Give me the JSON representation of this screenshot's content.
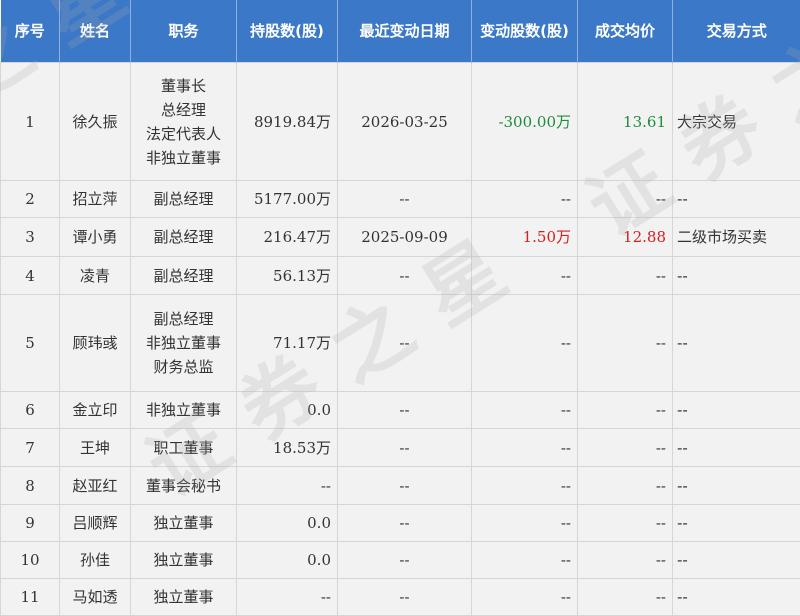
{
  "headers": {
    "seq": "序号",
    "name": "姓名",
    "position": "职务",
    "holding": "持股数(股)",
    "change_date": "最近变动日期",
    "change_shares": "变动股数(股)",
    "avg_price": "成交均价",
    "method": "交易方式"
  },
  "rows": [
    {
      "seq": "1",
      "name": "徐久振",
      "positions": [
        "董事长",
        "总经理",
        "法定代表人",
        "非独立董事"
      ],
      "holding": "8919.84万",
      "change_date": "2026-03-25",
      "change_shares": "-300.00万",
      "change_color": "#1e8c3c",
      "avg_price": "13.61",
      "price_color": "#1e8c3c",
      "method": "大宗交易"
    },
    {
      "seq": "2",
      "name": "招立萍",
      "positions": [
        "副总经理"
      ],
      "holding": "5177.00万",
      "change_date": "--",
      "change_shares": "--",
      "change_color": "#333333",
      "avg_price": "--",
      "price_color": "#333333",
      "method": "--"
    },
    {
      "seq": "3",
      "name": "谭小勇",
      "positions": [
        "副总经理"
      ],
      "holding": "216.47万",
      "change_date": "2025-09-09",
      "change_shares": "1.50万",
      "change_color": "#d42020",
      "avg_price": "12.88",
      "price_color": "#d42020",
      "method": "二级市场买卖"
    },
    {
      "seq": "4",
      "name": "凌青",
      "positions": [
        "副总经理"
      ],
      "holding": "56.13万",
      "change_date": "--",
      "change_shares": "--",
      "change_color": "#333333",
      "avg_price": "--",
      "price_color": "#333333",
      "method": "--"
    },
    {
      "seq": "5",
      "name": "顾玮彧",
      "positions": [
        "副总经理",
        "非独立董事",
        "财务总监"
      ],
      "holding": "71.17万",
      "change_date": "--",
      "change_shares": "--",
      "change_color": "#333333",
      "avg_price": "--",
      "price_color": "#333333",
      "method": "--"
    },
    {
      "seq": "6",
      "name": "金立印",
      "positions": [
        "非独立董事"
      ],
      "holding": "0.0",
      "change_date": "--",
      "change_shares": "--",
      "change_color": "#333333",
      "avg_price": "--",
      "price_color": "#333333",
      "method": "--"
    },
    {
      "seq": "7",
      "name": "王坤",
      "positions": [
        "职工董事"
      ],
      "holding": "18.53万",
      "change_date": "--",
      "change_shares": "--",
      "change_color": "#333333",
      "avg_price": "--",
      "price_color": "#333333",
      "method": "--"
    },
    {
      "seq": "8",
      "name": "赵亚红",
      "positions": [
        "董事会秘书"
      ],
      "holding": "--",
      "change_date": "--",
      "change_shares": "--",
      "change_color": "#333333",
      "avg_price": "--",
      "price_color": "#333333",
      "method": "--"
    },
    {
      "seq": "9",
      "name": "吕顺辉",
      "positions": [
        "独立董事"
      ],
      "holding": "0.0",
      "change_date": "--",
      "change_shares": "--",
      "change_color": "#333333",
      "avg_price": "--",
      "price_color": "#333333",
      "method": "--"
    },
    {
      "seq": "10",
      "name": "孙佳",
      "positions": [
        "独立董事"
      ],
      "holding": "0.0",
      "change_date": "--",
      "change_shares": "--",
      "change_color": "#333333",
      "avg_price": "--",
      "price_color": "#333333",
      "method": "--"
    },
    {
      "seq": "11",
      "name": "马如透",
      "positions": [
        "独立董事"
      ],
      "holding": "--",
      "change_date": "--",
      "change_shares": "--",
      "change_color": "#333333",
      "avg_price": "--",
      "price_color": "#333333",
      "method": "--"
    }
  ],
  "watermark": "证券之星"
}
